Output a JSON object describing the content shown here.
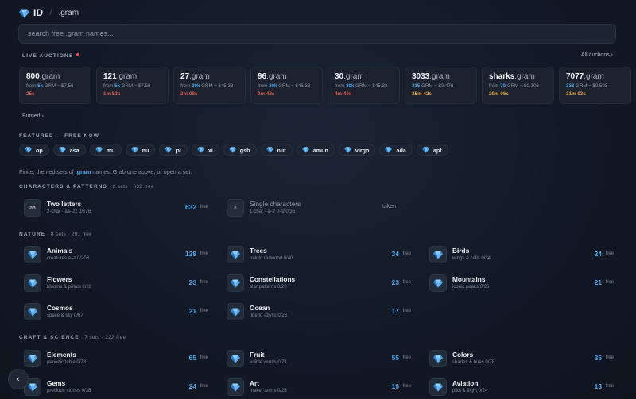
{
  "header": {
    "brand": "ID",
    "separator": "/",
    "tld": ".gram"
  },
  "search": {
    "placeholder": "search free .gram names..."
  },
  "live_auctions": {
    "label": "LIVE AUCTIONS",
    "all_link": "All auctions ›",
    "burned_link": "Burned ›",
    "items": [
      {
        "name": "800",
        "suffix": ".gram",
        "from": "from",
        "price": "5k",
        "rest": " GRM ≈ $7.56",
        "time": "25s",
        "urgency": "red"
      },
      {
        "name": "121",
        "suffix": ".gram",
        "from": "from",
        "price": "5k",
        "rest": " GRM ≈ $7.56",
        "time": "1m 53s",
        "urgency": "red"
      },
      {
        "name": "27",
        "suffix": ".gram",
        "from": "from",
        "price": "30k",
        "rest": " GRM ≈ $45.33",
        "time": "2m 08s",
        "urgency": "red"
      },
      {
        "name": "96",
        "suffix": ".gram",
        "from": "from",
        "price": "30k",
        "rest": " GRM ≈ $45.33",
        "time": "2m 42s",
        "urgency": "red"
      },
      {
        "name": "30",
        "suffix": ".gram",
        "from": "from",
        "price": "30k",
        "rest": " GRM ≈ $45.33",
        "time": "4m 40s",
        "urgency": "red"
      },
      {
        "name": "3033",
        "suffix": ".gram",
        "from": "",
        "price": "315",
        "rest": " GRM ≈ $0.476",
        "time": "25m 42s",
        "urgency": "orange"
      },
      {
        "name": "sharks",
        "suffix": ".gram",
        "from": "from",
        "price": "70",
        "rest": " GRM ≈ $0.106",
        "time": "29m 06s",
        "urgency": "orange"
      },
      {
        "name": "7077",
        "suffix": ".gram",
        "from": "",
        "price": "333",
        "rest": " GRM ≈ $0.503",
        "time": "31m 03s",
        "urgency": "orange"
      }
    ]
  },
  "featured": {
    "label": "FEATURED — FREE NOW",
    "chips": [
      "op",
      "asa",
      "mu",
      "nu",
      "pi",
      "xi",
      "gsb",
      "nut",
      "amun",
      "virgo",
      "ada",
      "apt"
    ]
  },
  "description": {
    "before": "Finite, themed sets of ",
    "highlight": ".gram",
    "after": " names. Grab one above, or open a set."
  },
  "sections": [
    {
      "label": "CHARACTERS & PATTERNS",
      "sub": " · 2 sets · 632 free",
      "items": [
        {
          "tile": "aa",
          "title": "Two letters",
          "meta": "2-char · aa–zz  0/676",
          "count": "632",
          "free": "free",
          "taken": ""
        },
        {
          "tile": "a",
          "title": "Single characters",
          "meta": "1-char · a–z 0–9  0/36",
          "count": "",
          "free": "",
          "taken": "taken"
        }
      ]
    },
    {
      "label": "NATURE",
      "sub": " · 8 sets · 291 free",
      "items": [
        {
          "title": "Animals",
          "meta": "creatures a–z  0/203",
          "count": "128",
          "free": "free"
        },
        {
          "title": "Trees",
          "meta": "oak to redwood  0/40",
          "count": "34",
          "free": "free"
        },
        {
          "title": "Birds",
          "meta": "wings & calls  0/34",
          "count": "24",
          "free": "free"
        },
        {
          "title": "Flowers",
          "meta": "blooms & petals  0/29",
          "count": "23",
          "free": "free"
        },
        {
          "title": "Constellations",
          "meta": "star patterns  0/28",
          "count": "23",
          "free": "free"
        },
        {
          "title": "Mountains",
          "meta": "iconic peaks  0/25",
          "count": "21",
          "free": "free"
        },
        {
          "title": "Cosmos",
          "meta": "space & sky  0/67",
          "count": "21",
          "free": "free"
        },
        {
          "title": "Ocean",
          "meta": "tide to abyss  0/28",
          "count": "17",
          "free": "free"
        }
      ]
    },
    {
      "label": "CRAFT & SCIENCE",
      "sub": " · 7 sets · 222 free",
      "items": [
        {
          "title": "Elements",
          "meta": "periodic table  0/73",
          "count": "65",
          "free": "free"
        },
        {
          "title": "Fruit",
          "meta": "edible words  0/71",
          "count": "55",
          "free": "free"
        },
        {
          "title": "Colors",
          "meta": "shades & hues  0/78",
          "count": "35",
          "free": "free"
        },
        {
          "title": "Gems",
          "meta": "precious stones  0/38",
          "count": "24",
          "free": "free"
        },
        {
          "title": "Art",
          "meta": "maker terms  0/23",
          "count": "19",
          "free": "free"
        },
        {
          "title": "Aviation",
          "meta": "pilot & flight  0/24",
          "count": "13",
          "free": "free"
        }
      ]
    }
  ],
  "back_button": {
    "glyph": "‹"
  },
  "colors": {
    "accent": "#4aa8f0",
    "urgent": "#e25a4f",
    "warning": "#e6a23b",
    "background": "#121926"
  }
}
